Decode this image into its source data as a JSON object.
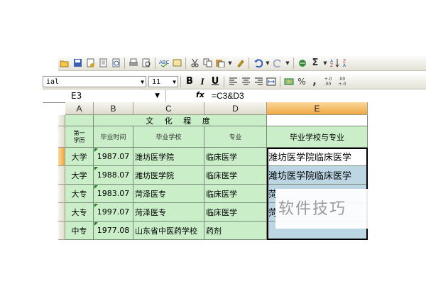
{
  "toolbar": {
    "standard_icons": [
      "open-icon",
      "save-icon",
      "permission-icon",
      "print-preview-icon",
      "spelling-icon",
      "research-icon",
      "cut-icon",
      "copy-icon",
      "paste-icon",
      "format-painter-icon",
      "undo-icon",
      "redo-icon",
      "hyperlink-icon",
      "autosum-icon",
      "sort-ascending-icon"
    ],
    "sum_symbol": "Σ",
    "font_name": "ial",
    "font_size": "11",
    "bold": "B",
    "italic": "I",
    "underline": "U",
    "percent": "%",
    "comma": ",",
    "increase_decimal": "+.0\n.00",
    "decrease_decimal": ".00\n+.0"
  },
  "formula_bar": {
    "name_box": "E3",
    "fx": "fx",
    "formula": "=C3&D3"
  },
  "columns": [
    "A",
    "B",
    "C",
    "D",
    "E"
  ],
  "title_row": "文 化 程 度",
  "header_row": {
    "a": "第一\n学历",
    "b": "毕业时间",
    "c": "毕业学校",
    "d": "专业",
    "e": "毕业学校与专业"
  },
  "rows": [
    {
      "a": "大学",
      "b": "1987.07",
      "c": "潍坊医学院",
      "d": "临床医学",
      "e": "潍坊医学院临床医学"
    },
    {
      "a": "大学",
      "b": "1988.07",
      "c": "潍坊医学院",
      "d": "临床医学",
      "e": "潍坊医学院临床医学"
    },
    {
      "a": "大专",
      "b": "1983.07",
      "c": "菏泽医专",
      "d": "临床医学",
      "e": "菏"
    },
    {
      "a": "大专",
      "b": "1997.07",
      "c": "菏泽医专",
      "d": "临床医学",
      "e": "菏"
    },
    {
      "a": "中专",
      "b": "1977.08",
      "c": "山东省中医药学校",
      "d": "药剂",
      "e": ""
    }
  ],
  "watermark": "软件技巧",
  "colors": {
    "cell_green": "#c9eec8",
    "active_header": "#f0a743",
    "selection": "#bcd6e4"
  }
}
